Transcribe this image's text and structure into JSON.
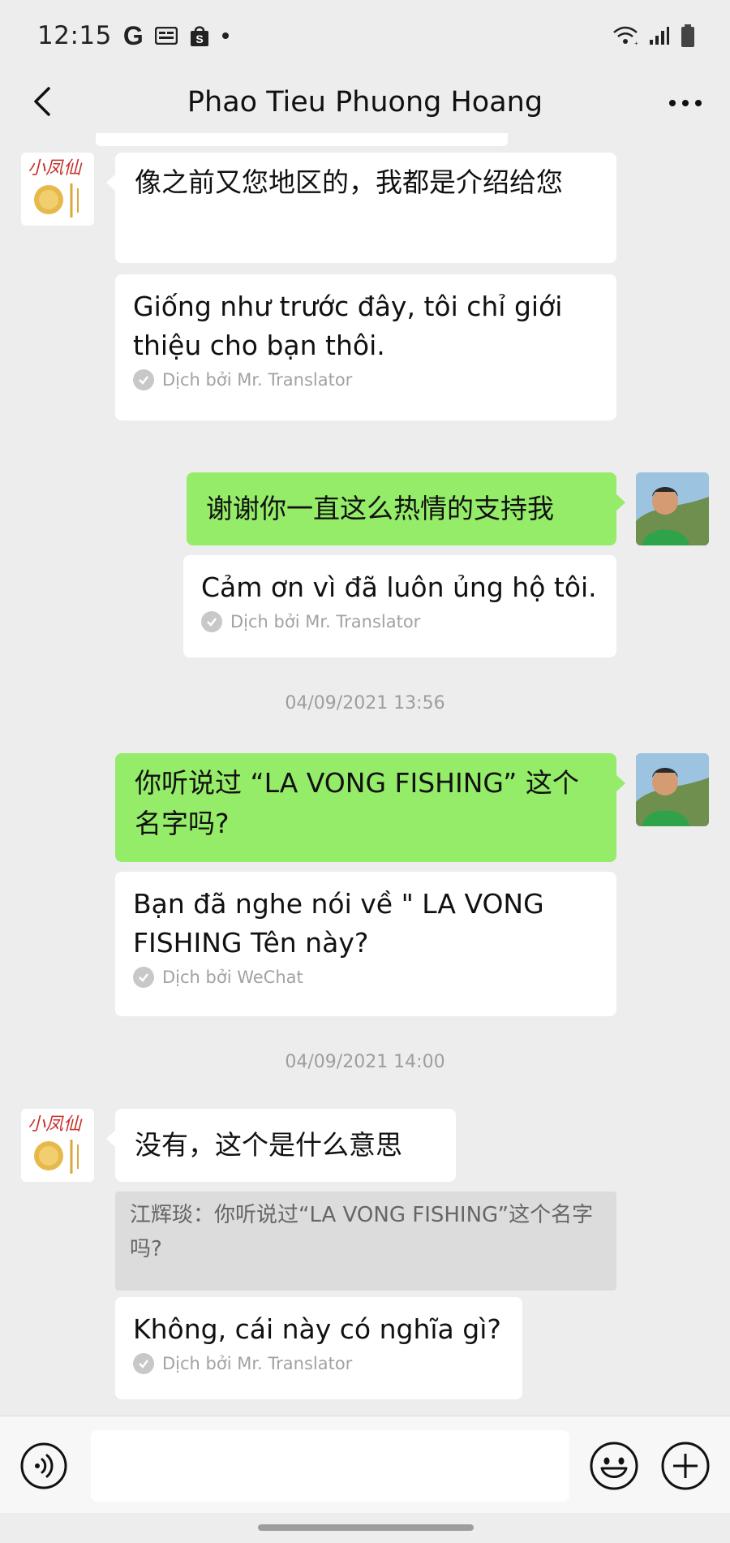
{
  "status_bar": {
    "time": "12:15",
    "icons": [
      "google-icon",
      "news-icon",
      "shopee-icon",
      "dot-icon",
      "wifi-icon",
      "signal-icon",
      "battery-icon"
    ],
    "g_letter": "G"
  },
  "header": {
    "title": "Phao Tieu Phuong Hoang"
  },
  "messages": [
    {
      "from": "shop",
      "text": "像之前又您地区的，我都是介绍给您",
      "translation": "Giống như trước đây, tôi chỉ giới thiệu cho bạn thôi.",
      "credit": "Dịch bởi Mr. Translator"
    },
    {
      "from": "me",
      "text": "谢谢你一直这么热情的支持我",
      "translation": "Cảm ơn vì đã luôn ủng hộ tôi.",
      "credit": "Dịch bởi Mr. Translator"
    },
    {
      "timestamp": "04/09/2021 13:56"
    },
    {
      "from": "me",
      "text": "你听说过 “LA VONG FISHING” 这个名字吗?",
      "translation": "Bạn đã nghe nói về \" LA VONG FISHING Tên này?",
      "credit": "Dịch bởi WeChat"
    },
    {
      "timestamp": "04/09/2021 14:00"
    },
    {
      "from": "shop",
      "text": "没有，这个是什么意思",
      "quote": "江辉琰：你听说过“LA VONG FISHING”这个名字吗?",
      "translation": "Không, cái này có nghĩa gì?",
      "credit": "Dịch bởi Mr. Translator"
    }
  ],
  "input": {
    "value": "",
    "placeholder": ""
  },
  "colors": {
    "background": "#ededed",
    "own_bubble": "#95ec69",
    "other_bubble": "#ffffff"
  }
}
